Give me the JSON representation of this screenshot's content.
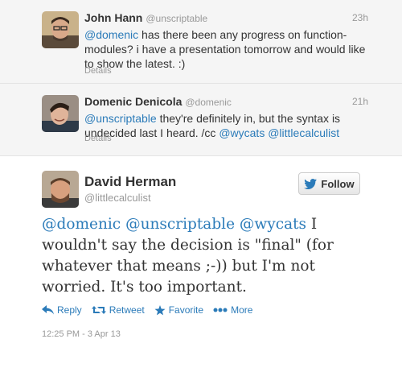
{
  "tweets": [
    {
      "name": "John Hann",
      "handle": "@unscriptable",
      "time": "23h",
      "text_mention": "@domenic",
      "text_rest": " has there been any progress on function-modules? i have a presentation tomorrow and would like to show the latest. :)",
      "details": "Details"
    },
    {
      "name": "Domenic Denicola",
      "handle": "@domenic",
      "time": "21h",
      "text_mention": "@unscriptable",
      "text_rest": " they're definitely in, but the syntax is undecided last I heard. /cc ",
      "mention2": "@wycats",
      "mention3": "@littlecalculist",
      "details": "Details"
    }
  ],
  "main": {
    "name": "David Herman",
    "handle": "@littlecalculist",
    "follow_label": "Follow",
    "mention1": "@domenic",
    "mention2": "@unscriptable",
    "mention3": "@wycats",
    "text_rest": " I wouldn't say the decision is \"final\" (for whatever that means ;-)) but I'm not worried. It's too important.",
    "actions": {
      "reply": "Reply",
      "retweet": "Retweet",
      "favorite": "Favorite",
      "more": "More"
    },
    "timestamp": "12:25 PM - 3 Apr 13"
  },
  "colors": {
    "link": "#2b7bb9",
    "context_bg": "#f5f5f5",
    "muted": "#999999"
  },
  "icons": [
    "bird-icon",
    "reply-icon",
    "retweet-icon",
    "star-icon",
    "more-dots-icon"
  ]
}
